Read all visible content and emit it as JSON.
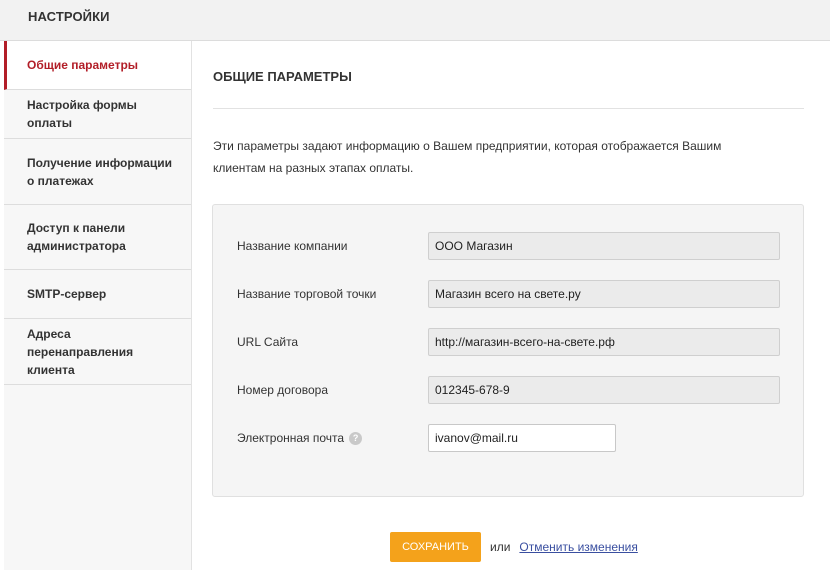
{
  "header": {
    "title": "НАСТРОЙКИ"
  },
  "sidebar": {
    "items": [
      {
        "label": "Общие параметры",
        "active": true
      },
      {
        "label": "Настройка формы оплаты"
      },
      {
        "label": "Получение информации о платежах"
      },
      {
        "label": "Доступ к панели администратора"
      },
      {
        "label": "SMTP-сервер"
      },
      {
        "label": "Адреса перенаправления клиента"
      }
    ]
  },
  "main": {
    "title": "ОБЩИЕ ПАРАМЕТРЫ",
    "description": "Эти параметры задают информацию о Вашем предприятии, которая отображается Вашим клиентам на разных этапах оплаты.",
    "fields": [
      {
        "label": "Название компании",
        "value": "ООО Магазин"
      },
      {
        "label": "Название торговой точки",
        "value": "Магазин всего на свете.ру"
      },
      {
        "label": "URL Сайта",
        "value": "http://магазин-всего-на-свете.рф"
      },
      {
        "label": "Номер договора",
        "value": "012345-678-9"
      },
      {
        "label": "Электронная почта",
        "value": "ivanov@mail.ru",
        "help": "?"
      }
    ],
    "actions": {
      "save_label": "СОХРАНИТЬ",
      "or_text": "или",
      "cancel_label": "Отменить изменения"
    }
  },
  "colors": {
    "accent": "#b21e28",
    "save_button": "#f4a21b",
    "link": "#3a4fa0"
  }
}
